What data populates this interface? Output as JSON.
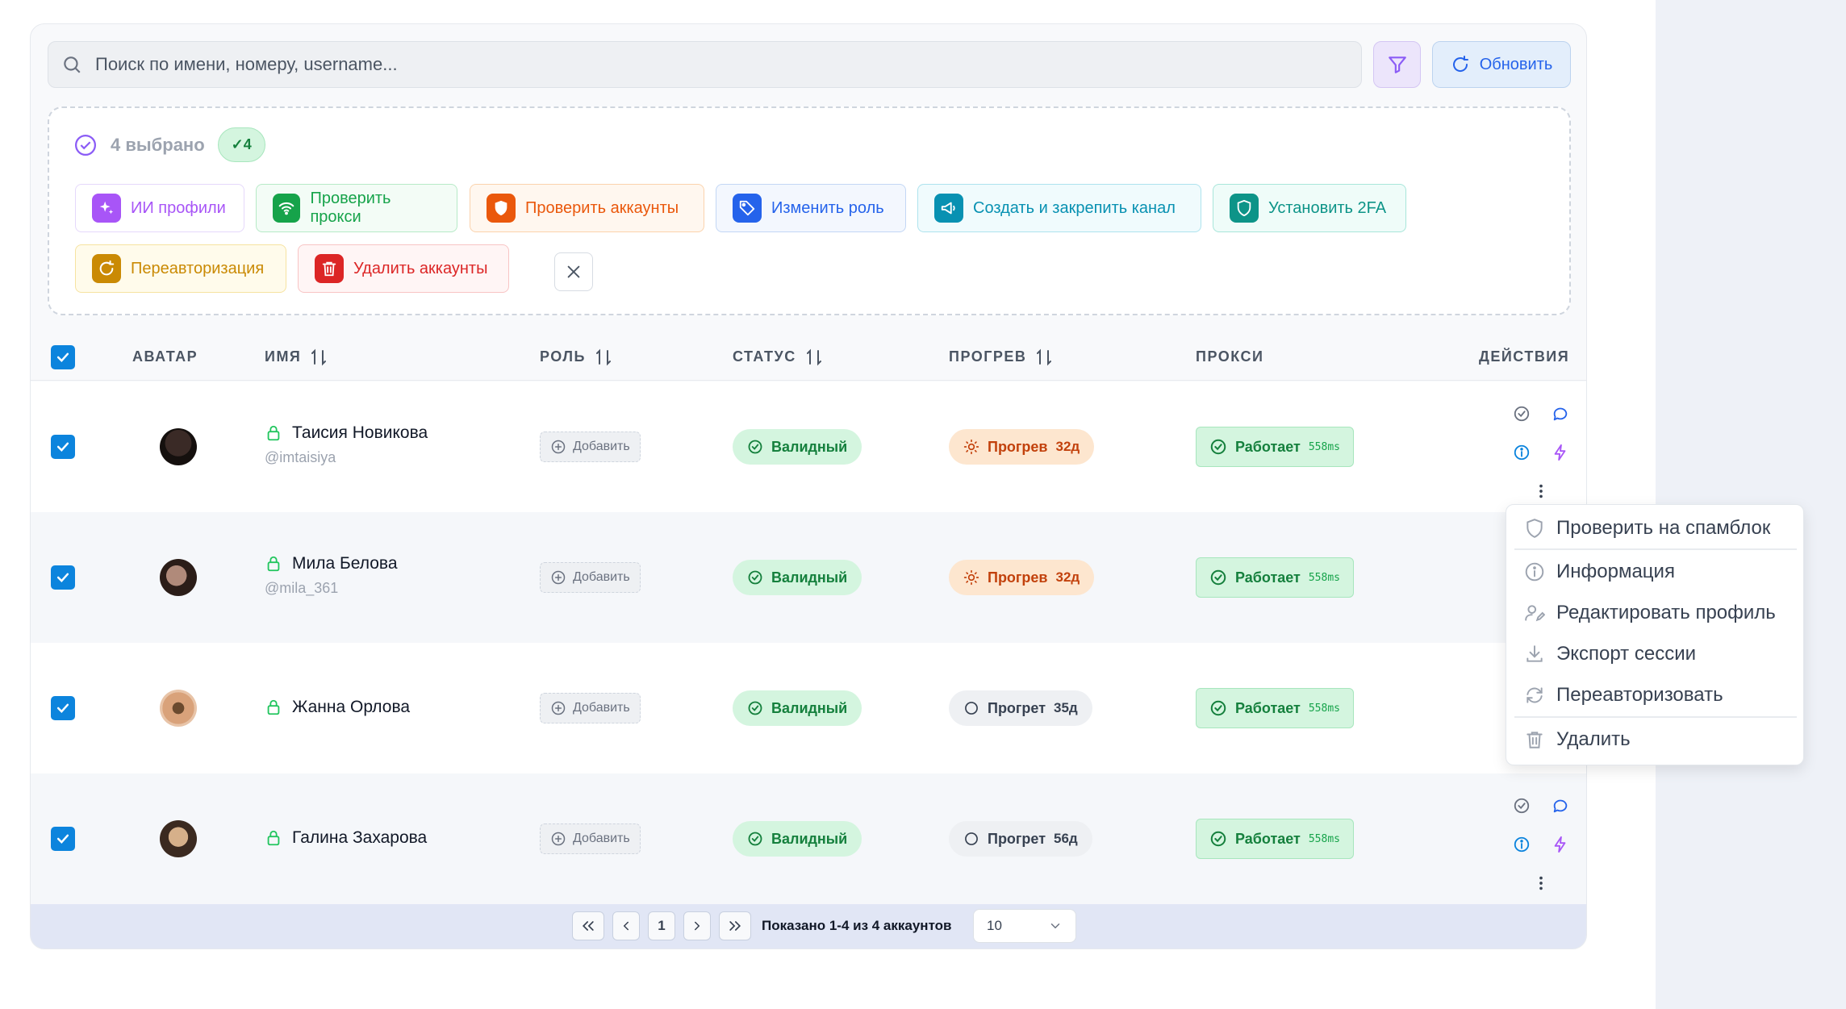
{
  "search": {
    "placeholder": "Поиск по имени, номеру, username..."
  },
  "toolbar": {
    "refresh_label": "Обновить"
  },
  "selection": {
    "count_label": "4 выбрано",
    "badge": "✓4",
    "actions": [
      {
        "label": "ИИ профили",
        "color": "#a855f7",
        "icon": "sparkle-icon"
      },
      {
        "label": "Проверить прокси",
        "color": "#16a34a",
        "icon": "wifi-icon"
      },
      {
        "label": "Проверить аккаунты",
        "color": "#ea580c",
        "icon": "shield-icon"
      },
      {
        "label": "Изменить роль",
        "color": "#2563eb",
        "icon": "tag-icon"
      },
      {
        "label": "Создать и закрепить канал",
        "color": "#0891b2",
        "icon": "megaphone-icon"
      },
      {
        "label": "Установить 2FA",
        "color": "#0d9488",
        "icon": "shield-check-icon"
      },
      {
        "label": "Переавторизация",
        "color": "#ca8a04",
        "icon": "refresh-icon"
      },
      {
        "label": "Удалить аккаунты",
        "color": "#dc2626",
        "icon": "trash-icon"
      }
    ]
  },
  "table": {
    "headers": {
      "avatar": "АВАТАР",
      "name": "ИМЯ",
      "role": "РОЛЬ",
      "status": "СТАТУС",
      "warmup": "ПРОГРЕВ",
      "proxy": "ПРОКСИ",
      "actions": "ДЕЙСТВИЯ"
    },
    "rows": [
      {
        "name": "Таисия Новикова",
        "username": "@imtaisiya",
        "role": "Добавить",
        "status": "Валидный",
        "warmup": "Прогрев",
        "warmup_days": "32д",
        "warmup_state": "warming",
        "proxy": "Работает",
        "ms": "558ms"
      },
      {
        "name": "Мила Белова",
        "username": "@mila_361",
        "role": "Добавить",
        "status": "Валидный",
        "warmup": "Прогрев",
        "warmup_days": "32д",
        "warmup_state": "warming",
        "proxy": "Работает",
        "ms": "558ms"
      },
      {
        "name": "Жанна Орлова",
        "username": "",
        "role": "Добавить",
        "status": "Валидный",
        "warmup": "Прогрет",
        "warmup_days": "35д",
        "warmup_state": "warmed",
        "proxy": "Работает",
        "ms": "558ms"
      },
      {
        "name": "Галина Захарова",
        "username": "",
        "role": "Добавить",
        "status": "Валидный",
        "warmup": "Прогрет",
        "warmup_days": "56д",
        "warmup_state": "warmed",
        "proxy": "Работает",
        "ms": "558ms"
      }
    ]
  },
  "pagination": {
    "current_page": "1",
    "info": "Показано 1-4 из 4 аккаунтов",
    "page_size": "10"
  },
  "context_menu": {
    "items": [
      {
        "label": "Проверить на спамблок",
        "icon": "shield-outline-icon"
      },
      {
        "label": "Информация",
        "icon": "info-icon"
      },
      {
        "label": "Редактировать профиль",
        "icon": "user-edit-icon"
      },
      {
        "label": "Экспорт сессии",
        "icon": "download-icon"
      },
      {
        "label": "Переавторизовать",
        "icon": "refresh-icon"
      },
      {
        "label": "Удалить",
        "icon": "trash-icon"
      }
    ]
  },
  "colors": {
    "accent_blue": "#0c84dd",
    "valid_green": "#15803d",
    "warming_orange": "#c2410c"
  }
}
